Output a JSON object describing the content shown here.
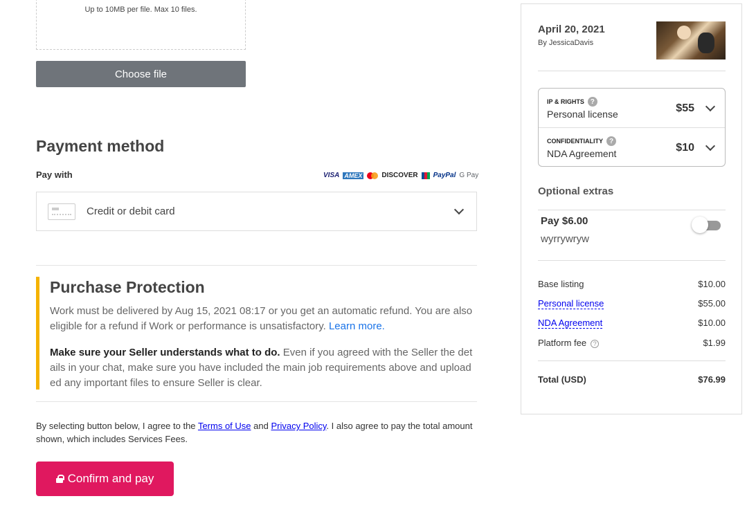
{
  "upload": {
    "hint": "Up to 10MB per file. Max 10 files.",
    "choose_label": "Choose file"
  },
  "payment": {
    "title": "Payment method",
    "pay_with": "Pay with",
    "card_brands": [
      "VISA",
      "AMEX",
      "mastercard",
      "DISCOVER",
      "JCB",
      "PayPal",
      "G Pay"
    ],
    "selected_method": "Credit or debit card"
  },
  "protection": {
    "title": "Purchase Protection",
    "text1": "Work must be delivered by Aug 15, 2021 08:17 or you get an automatic refund. You are also eligible for a refund if Work or performance is unsatisfactory.",
    "learn_more": "Learn more.",
    "bold_lead": "Make sure your Seller understands what to do.",
    "text2": "Even if you agreed with the Seller the details in your chat, make sure you have included the main job requirements above and uploaded any important files to ensure Seller is clear."
  },
  "terms": {
    "prefix": "By selecting button below, I agree to the",
    "terms_link": "Terms of Use",
    "and": "and",
    "privacy_link": "Privacy Policy",
    "suffix": ". I also agree to pay the total amount shown, which includes Services Fees."
  },
  "confirm_label": "Confirm and pay",
  "summary": {
    "date": "April 20, 2021",
    "by": "By JessicaDavis",
    "options": [
      {
        "heading": "IP & RIGHTS",
        "name": "Personal license",
        "price": "$55"
      },
      {
        "heading": "CONFIDENTIALITY",
        "name": "NDA Agreement",
        "price": "$10"
      }
    ],
    "extras_title": "Optional extras",
    "extra": {
      "price_label": "Pay $6.00",
      "description": "wyrrywryw",
      "enabled": false
    },
    "lines": [
      {
        "label": "Base listing",
        "amount": "$10.00"
      },
      {
        "label": "Personal license",
        "amount": "$55.00"
      },
      {
        "label": "NDA Agreement",
        "amount": "$10.00"
      },
      {
        "label": "Platform fee",
        "amount": "$1.99"
      }
    ],
    "total_label": "Total (USD)",
    "total_amount": "$76.99"
  },
  "colors": {
    "accent": "#e0185f",
    "protection_bar": "#f5b300",
    "button_gray": "#6f747a"
  }
}
